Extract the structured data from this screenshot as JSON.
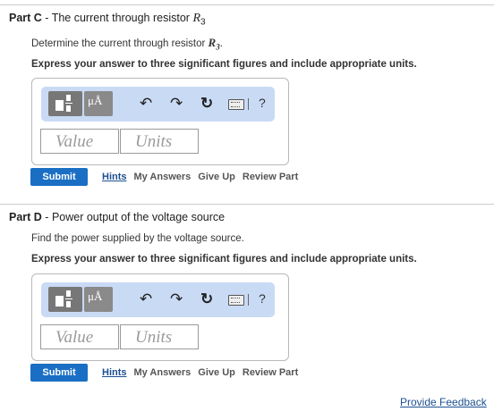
{
  "parts": [
    {
      "label": "Part C",
      "dash": " - ",
      "title_text": "The current through resistor ",
      "title_var": "R",
      "title_sub": "3",
      "prompt_text": "Determine the current through resistor ",
      "prompt_var": "R",
      "prompt_sub": "3",
      "prompt_end": ".",
      "instruction": "Express your answer to three significant figures and include appropriate units.",
      "value_placeholder": "Value",
      "units_placeholder": "Units",
      "submit_label": "Submit",
      "hints_label": "Hints",
      "my_answers_label": "My Answers",
      "give_up_label": "Give Up",
      "review_part_label": "Review Part"
    },
    {
      "label": "Part D",
      "dash": " - ",
      "title_text": "Power output of the voltage source",
      "prompt_text": "Find the power supplied by the voltage source.",
      "instruction": "Express your answer to three significant figures and include appropriate units.",
      "value_placeholder": "Value",
      "units_placeholder": "Units",
      "submit_label": "Submit",
      "hints_label": "Hints",
      "my_answers_label": "My Answers",
      "give_up_label": "Give Up",
      "review_part_label": "Review Part"
    }
  ],
  "toolbar": {
    "units_glyph": "μÅ",
    "undo_glyph": "↶",
    "redo_glyph": "↷",
    "reset_glyph": "↻",
    "help_glyph": "?",
    "icons": [
      "fraction-template-icon",
      "units-template-icon",
      "undo-icon",
      "redo-icon",
      "reset-icon",
      "keyboard-icon",
      "help-icon"
    ]
  },
  "footer": {
    "feedback_label": "Provide Feedback"
  },
  "colors": {
    "submit_bg": "#1a6fc4",
    "toolbar_bg": "#c9daf5",
    "link": "#1d4f91"
  }
}
